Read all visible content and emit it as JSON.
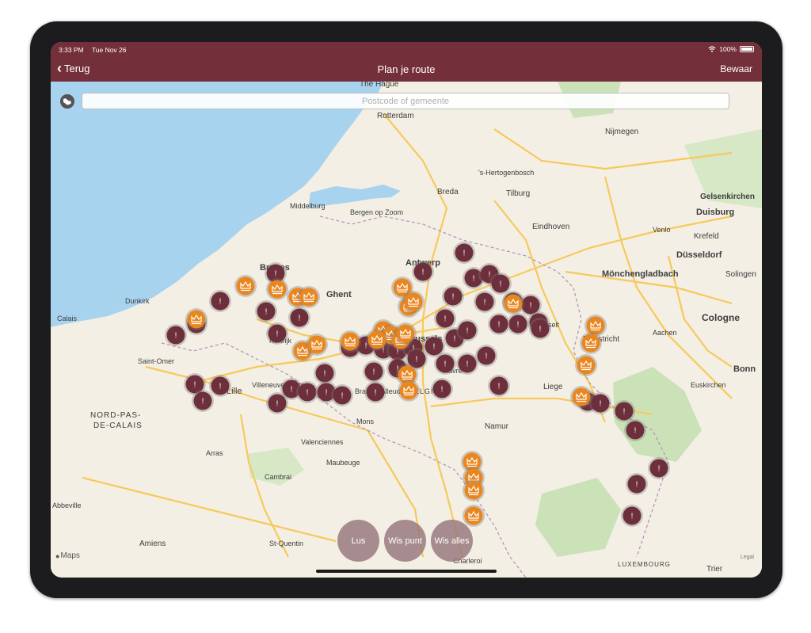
{
  "status_bar": {
    "time": "3:33 PM",
    "date": "Tue Nov 26",
    "battery": "100%"
  },
  "nav": {
    "back_label": "Terug",
    "title": "Plan je route",
    "save_label": "Bewaar"
  },
  "search": {
    "placeholder": "Postcode of gemeente",
    "value": ""
  },
  "map": {
    "labels": {
      "the_hague": "The Hague",
      "rotterdam": "Rotterdam",
      "hertogenbosch": "'s-Hertogenbosch",
      "tilburg": "Tilburg",
      "breda": "Breda",
      "eindhoven": "Eindhoven",
      "nijmegen": "Nijmegen",
      "duisburg": "Duisburg",
      "gelsenkirchen": "Gelsenkirchen",
      "krefeld": "Krefeld",
      "dusseldorf": "Düsseldorf",
      "monchengladbach": "Mönchengladbach",
      "solingen": "Solingen",
      "cologne": "Cologne",
      "bonn": "Bonn",
      "maastricht": "Maastricht",
      "liege": "Liege",
      "namur": "Namur",
      "brussels": "Brussels",
      "antwerp": "Antwerp",
      "ghent": "Ghent",
      "bruges": "Bruges",
      "middelburg": "Middelburg",
      "bergen_op_zoom": "Bergen op Zoom",
      "dunkirk": "Dunkirk",
      "calais": "Calais",
      "lille": "Lille",
      "amiens": "Amiens",
      "saint_quentin": "St-Quentin",
      "belgium": "BELGIUM",
      "nord_pas_de_calais_1": "NORD-PAS-",
      "nord_pas_de_calais_2": "DE-CALAIS",
      "luxembourg": "LUXEMBOURG",
      "hasselt": "Hasselt",
      "wavre": "Wavre",
      "mons": "Mons",
      "charleroi": "Charleroi",
      "valenciennes": "Valenciennes",
      "cambrai": "Cambrai",
      "arras": "Arras",
      "trier": "Trier",
      "euskirchen": "Euskirchen",
      "aachen": "Aachen",
      "venlo": "Venlo",
      "abbeville": "Abbeville",
      "maubeuge": "Maubeuge",
      "braine": "Braine-l'Alleud",
      "kortrijk": "Kortrijk",
      "saint_omer": "Saint-Omer",
      "villeneuve": "Villeneuve-d'Ascq"
    },
    "colors": {
      "sea": "#a8d3ee",
      "land": "#f3efe4",
      "poi_dark": "#6e2f3c",
      "poi_orange": "#e9861f",
      "road": "#f7c95c",
      "border": "#b490b8"
    }
  },
  "buttons": {
    "loop": "Lus",
    "clear_point": "Wis punt",
    "clear_all": "Wis alles"
  },
  "attribution": {
    "maps": "Maps",
    "legal": "Legal"
  },
  "icons": {
    "back": "chevron-left-icon",
    "locate": "globe-icon",
    "wifi": "wifi-icon",
    "battery": "battery-icon",
    "dark_marker": "exclamation-marker-icon",
    "orange_marker": "crown-marker-icon"
  }
}
